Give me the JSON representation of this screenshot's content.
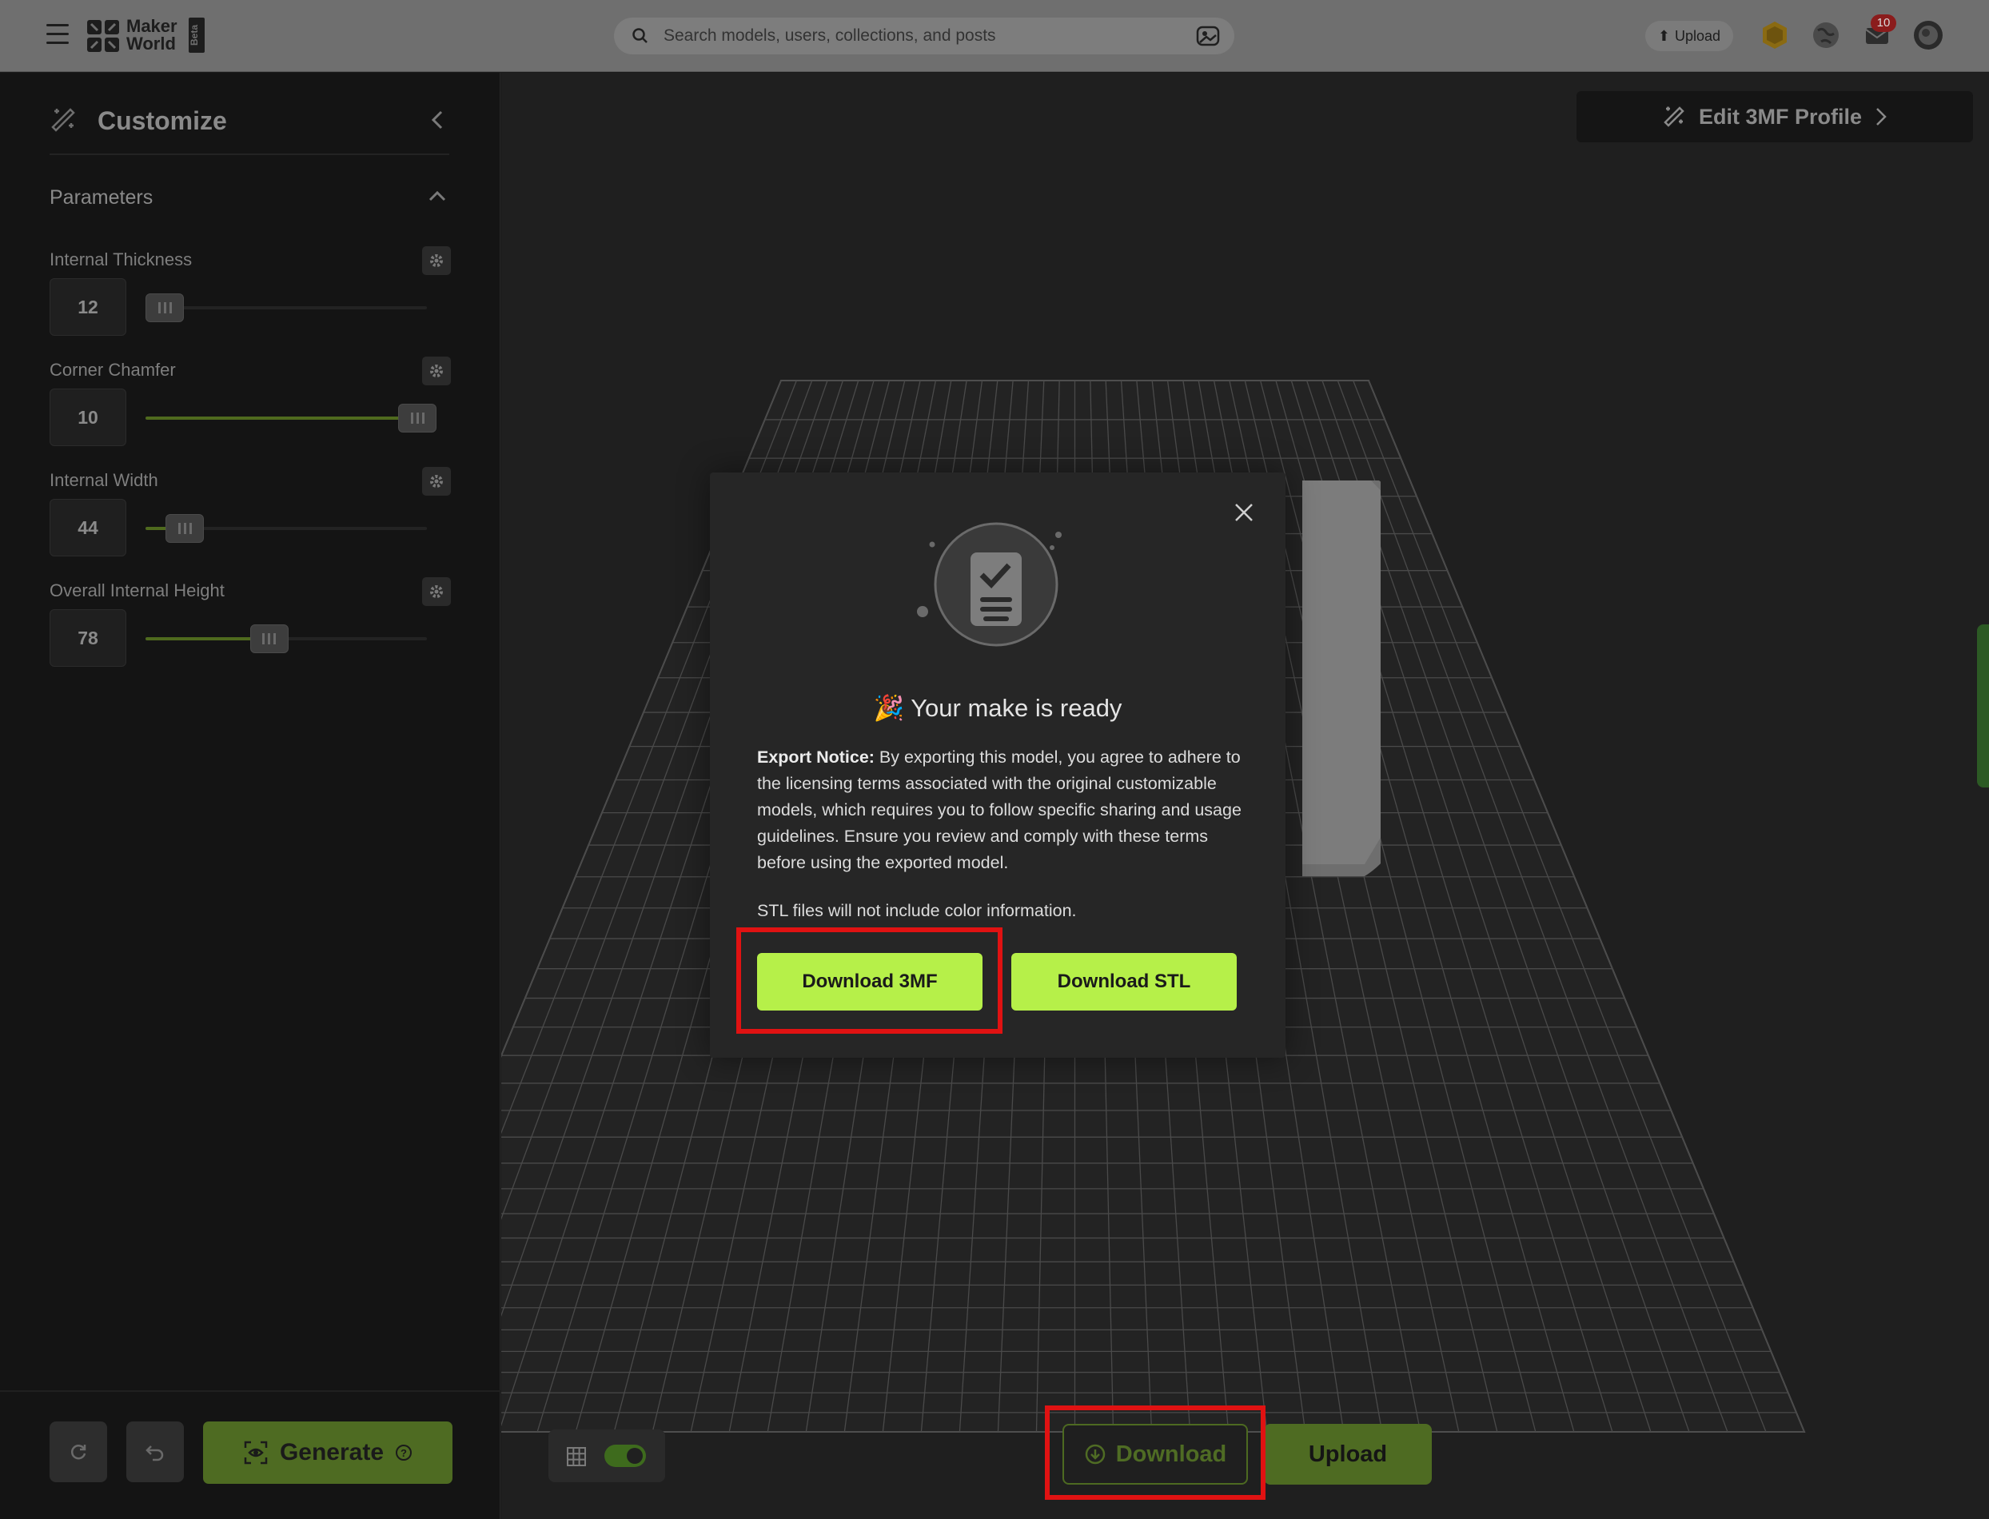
{
  "topbar": {
    "logo_line1": "Maker",
    "logo_line2": "World",
    "beta": "Beta",
    "search_placeholder": "Search models, users, collections, and posts",
    "upload_label": "Upload",
    "notification_count": "10"
  },
  "sidebar": {
    "title": "Customize",
    "section_label": "Parameters",
    "params": [
      {
        "name": "Internal Thickness",
        "value": "12",
        "fill_fraction": 0.04
      },
      {
        "name": "Corner Chamfer",
        "value": "10",
        "fill_fraction": 0.98
      },
      {
        "name": "Internal Width",
        "value": "44",
        "fill_fraction": 0.14
      },
      {
        "name": "Overall Internal Height",
        "value": "78",
        "fill_fraction": 0.44
      }
    ],
    "generate_label": "Generate"
  },
  "viewport": {
    "edit_profile_label": "Edit 3MF Profile",
    "download_label": "Download",
    "upload_label": "Upload"
  },
  "modal": {
    "title_emoji": "🎉",
    "title": "Your make is ready",
    "notice_bold": "Export Notice:",
    "notice_text": " By exporting this model, you agree to adhere to the licensing terms associated with the original customizable models, which requires you to follow specific sharing and usage guidelines. Ensure you review and comply with these terms before using the exported model.",
    "stl_note": "STL files will not include color information.",
    "download_3mf_label": "Download 3MF",
    "download_stl_label": "Download STL"
  },
  "colors": {
    "accent_lime": "#b6f049",
    "highlight_red": "#e01212",
    "dim_green": "#4e6b22"
  }
}
